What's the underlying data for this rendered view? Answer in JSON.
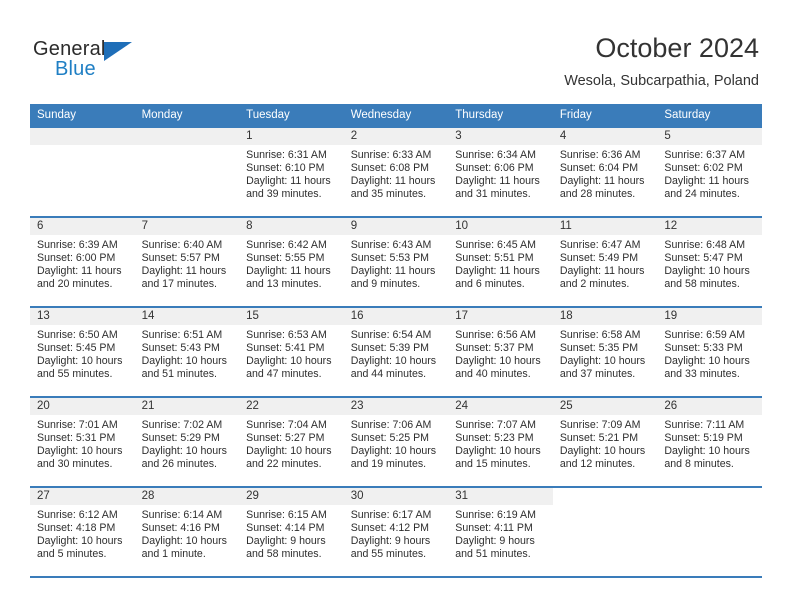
{
  "brand": {
    "name_part1": "General",
    "name_part2": "Blue",
    "triangle_color": "#1e6eb8",
    "blue_color": "#1f7fc4"
  },
  "header": {
    "title": "October 2024",
    "subtitle": "Wesola, Subcarpathia, Poland"
  },
  "theme": {
    "header_row_bg": "#3a7cba",
    "daynum_band_bg": "#f0f0f0",
    "row_border": "#3a7cba"
  },
  "weekday_headers": [
    "Sunday",
    "Monday",
    "Tuesday",
    "Wednesday",
    "Thursday",
    "Friday",
    "Saturday"
  ],
  "labels": {
    "sunrise_prefix": "Sunrise:",
    "sunset_prefix": "Sunset:",
    "daylight_prefix": "Daylight:"
  },
  "weeks": [
    [
      {
        "day": "",
        "sunrise": "",
        "sunset": "",
        "daylight": "",
        "empty": true
      },
      {
        "day": "",
        "sunrise": "",
        "sunset": "",
        "daylight": "",
        "empty": true
      },
      {
        "day": "1",
        "sunrise": "Sunrise: 6:31 AM",
        "sunset": "Sunset: 6:10 PM",
        "daylight": "Daylight: 11 hours and 39 minutes."
      },
      {
        "day": "2",
        "sunrise": "Sunrise: 6:33 AM",
        "sunset": "Sunset: 6:08 PM",
        "daylight": "Daylight: 11 hours and 35 minutes."
      },
      {
        "day": "3",
        "sunrise": "Sunrise: 6:34 AM",
        "sunset": "Sunset: 6:06 PM",
        "daylight": "Daylight: 11 hours and 31 minutes."
      },
      {
        "day": "4",
        "sunrise": "Sunrise: 6:36 AM",
        "sunset": "Sunset: 6:04 PM",
        "daylight": "Daylight: 11 hours and 28 minutes."
      },
      {
        "day": "5",
        "sunrise": "Sunrise: 6:37 AM",
        "sunset": "Sunset: 6:02 PM",
        "daylight": "Daylight: 11 hours and 24 minutes."
      }
    ],
    [
      {
        "day": "6",
        "sunrise": "Sunrise: 6:39 AM",
        "sunset": "Sunset: 6:00 PM",
        "daylight": "Daylight: 11 hours and 20 minutes."
      },
      {
        "day": "7",
        "sunrise": "Sunrise: 6:40 AM",
        "sunset": "Sunset: 5:57 PM",
        "daylight": "Daylight: 11 hours and 17 minutes."
      },
      {
        "day": "8",
        "sunrise": "Sunrise: 6:42 AM",
        "sunset": "Sunset: 5:55 PM",
        "daylight": "Daylight: 11 hours and 13 minutes."
      },
      {
        "day": "9",
        "sunrise": "Sunrise: 6:43 AM",
        "sunset": "Sunset: 5:53 PM",
        "daylight": "Daylight: 11 hours and 9 minutes."
      },
      {
        "day": "10",
        "sunrise": "Sunrise: 6:45 AM",
        "sunset": "Sunset: 5:51 PM",
        "daylight": "Daylight: 11 hours and 6 minutes."
      },
      {
        "day": "11",
        "sunrise": "Sunrise: 6:47 AM",
        "sunset": "Sunset: 5:49 PM",
        "daylight": "Daylight: 11 hours and 2 minutes."
      },
      {
        "day": "12",
        "sunrise": "Sunrise: 6:48 AM",
        "sunset": "Sunset: 5:47 PM",
        "daylight": "Daylight: 10 hours and 58 minutes."
      }
    ],
    [
      {
        "day": "13",
        "sunrise": "Sunrise: 6:50 AM",
        "sunset": "Sunset: 5:45 PM",
        "daylight": "Daylight: 10 hours and 55 minutes."
      },
      {
        "day": "14",
        "sunrise": "Sunrise: 6:51 AM",
        "sunset": "Sunset: 5:43 PM",
        "daylight": "Daylight: 10 hours and 51 minutes."
      },
      {
        "day": "15",
        "sunrise": "Sunrise: 6:53 AM",
        "sunset": "Sunset: 5:41 PM",
        "daylight": "Daylight: 10 hours and 47 minutes."
      },
      {
        "day": "16",
        "sunrise": "Sunrise: 6:54 AM",
        "sunset": "Sunset: 5:39 PM",
        "daylight": "Daylight: 10 hours and 44 minutes."
      },
      {
        "day": "17",
        "sunrise": "Sunrise: 6:56 AM",
        "sunset": "Sunset: 5:37 PM",
        "daylight": "Daylight: 10 hours and 40 minutes."
      },
      {
        "day": "18",
        "sunrise": "Sunrise: 6:58 AM",
        "sunset": "Sunset: 5:35 PM",
        "daylight": "Daylight: 10 hours and 37 minutes."
      },
      {
        "day": "19",
        "sunrise": "Sunrise: 6:59 AM",
        "sunset": "Sunset: 5:33 PM",
        "daylight": "Daylight: 10 hours and 33 minutes."
      }
    ],
    [
      {
        "day": "20",
        "sunrise": "Sunrise: 7:01 AM",
        "sunset": "Sunset: 5:31 PM",
        "daylight": "Daylight: 10 hours and 30 minutes."
      },
      {
        "day": "21",
        "sunrise": "Sunrise: 7:02 AM",
        "sunset": "Sunset: 5:29 PM",
        "daylight": "Daylight: 10 hours and 26 minutes."
      },
      {
        "day": "22",
        "sunrise": "Sunrise: 7:04 AM",
        "sunset": "Sunset: 5:27 PM",
        "daylight": "Daylight: 10 hours and 22 minutes."
      },
      {
        "day": "23",
        "sunrise": "Sunrise: 7:06 AM",
        "sunset": "Sunset: 5:25 PM",
        "daylight": "Daylight: 10 hours and 19 minutes."
      },
      {
        "day": "24",
        "sunrise": "Sunrise: 7:07 AM",
        "sunset": "Sunset: 5:23 PM",
        "daylight": "Daylight: 10 hours and 15 minutes."
      },
      {
        "day": "25",
        "sunrise": "Sunrise: 7:09 AM",
        "sunset": "Sunset: 5:21 PM",
        "daylight": "Daylight: 10 hours and 12 minutes."
      },
      {
        "day": "26",
        "sunrise": "Sunrise: 7:11 AM",
        "sunset": "Sunset: 5:19 PM",
        "daylight": "Daylight: 10 hours and 8 minutes."
      }
    ],
    [
      {
        "day": "27",
        "sunrise": "Sunrise: 6:12 AM",
        "sunset": "Sunset: 4:18 PM",
        "daylight": "Daylight: 10 hours and 5 minutes."
      },
      {
        "day": "28",
        "sunrise": "Sunrise: 6:14 AM",
        "sunset": "Sunset: 4:16 PM",
        "daylight": "Daylight: 10 hours and 1 minute."
      },
      {
        "day": "29",
        "sunrise": "Sunrise: 6:15 AM",
        "sunset": "Sunset: 4:14 PM",
        "daylight": "Daylight: 9 hours and 58 minutes."
      },
      {
        "day": "30",
        "sunrise": "Sunrise: 6:17 AM",
        "sunset": "Sunset: 4:12 PM",
        "daylight": "Daylight: 9 hours and 55 minutes."
      },
      {
        "day": "31",
        "sunrise": "Sunrise: 6:19 AM",
        "sunset": "Sunset: 4:11 PM",
        "daylight": "Daylight: 9 hours and 51 minutes."
      },
      {
        "day": "",
        "sunrise": "",
        "sunset": "",
        "daylight": "",
        "empty": true,
        "blank": true
      },
      {
        "day": "",
        "sunrise": "",
        "sunset": "",
        "daylight": "",
        "empty": true,
        "blank": true
      }
    ]
  ]
}
